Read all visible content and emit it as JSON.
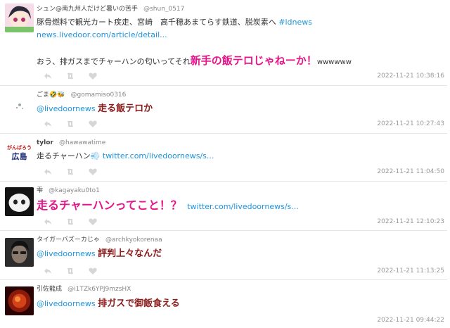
{
  "tweets": [
    {
      "display_name": "シュン@南九州人だけど暑いの苦手",
      "screen_name": "@shun_0517",
      "line1": "豚骨燃料で観光カート疾走、宮崎　高千穂あまてらす鉄道、脱炭素へ",
      "hashtag": "#ldnews",
      "link": "news.livedoor.com/article/detail...",
      "line3_prefix": "おう、排ガスまでチャーハンの匂いってそれ",
      "line3_emph": "新手の飯テロじゃねーか！",
      "line3_suffix": "wwwwww",
      "time": "2022-11-21 10:38:16",
      "avatar_color": "#e7b7c9"
    },
    {
      "display_name": "ごま🤣🐝",
      "screen_name": "@gomamiso0316",
      "mention": "@livedoornews",
      "text": "走る飯テロか",
      "time": "2022-11-21 10:27:43",
      "avatar_color": "#ffffff"
    },
    {
      "display_name": "tylor",
      "screen_name": "@hawawatime",
      "text": "走るチャーハン💨",
      "link": "twitter.com/livedoornews/s...",
      "time": "2022-11-21 11:04:50",
      "avatar_text_top": "がんばろう",
      "avatar_text_bottom": "広島"
    },
    {
      "display_name": "雫",
      "screen_name": "@kagayaku0to1",
      "text": "走るチャーハンってこと！？",
      "link": "twitter.com/livedoornews/s...",
      "time": "2022-11-21 12:10:23",
      "avatar_color": "#1a1a1a"
    },
    {
      "display_name": "タイガーバズーカじゃ",
      "screen_name": "@archkyokorenaa",
      "mention": "@livedoornews",
      "text": "評判上々なんだ",
      "time": "2022-11-21 11:13:25",
      "avatar_color": "#3a3a3a"
    },
    {
      "display_name": "引佐龍成",
      "screen_name": "@i1TZk6YPJ9mzsHX",
      "mention": "@livedoornews",
      "text": "排ガスで御飯食える",
      "time": "2022-11-21 09:44:22",
      "avatar_color": "#6a0d0d"
    }
  ],
  "icons": [
    "reply-icon",
    "retweet-icon",
    "like-icon"
  ],
  "colors": {
    "link": "#1b95e0",
    "pink_emphasis": "#e6168a",
    "red_emphasis": "#8b1a1a"
  }
}
